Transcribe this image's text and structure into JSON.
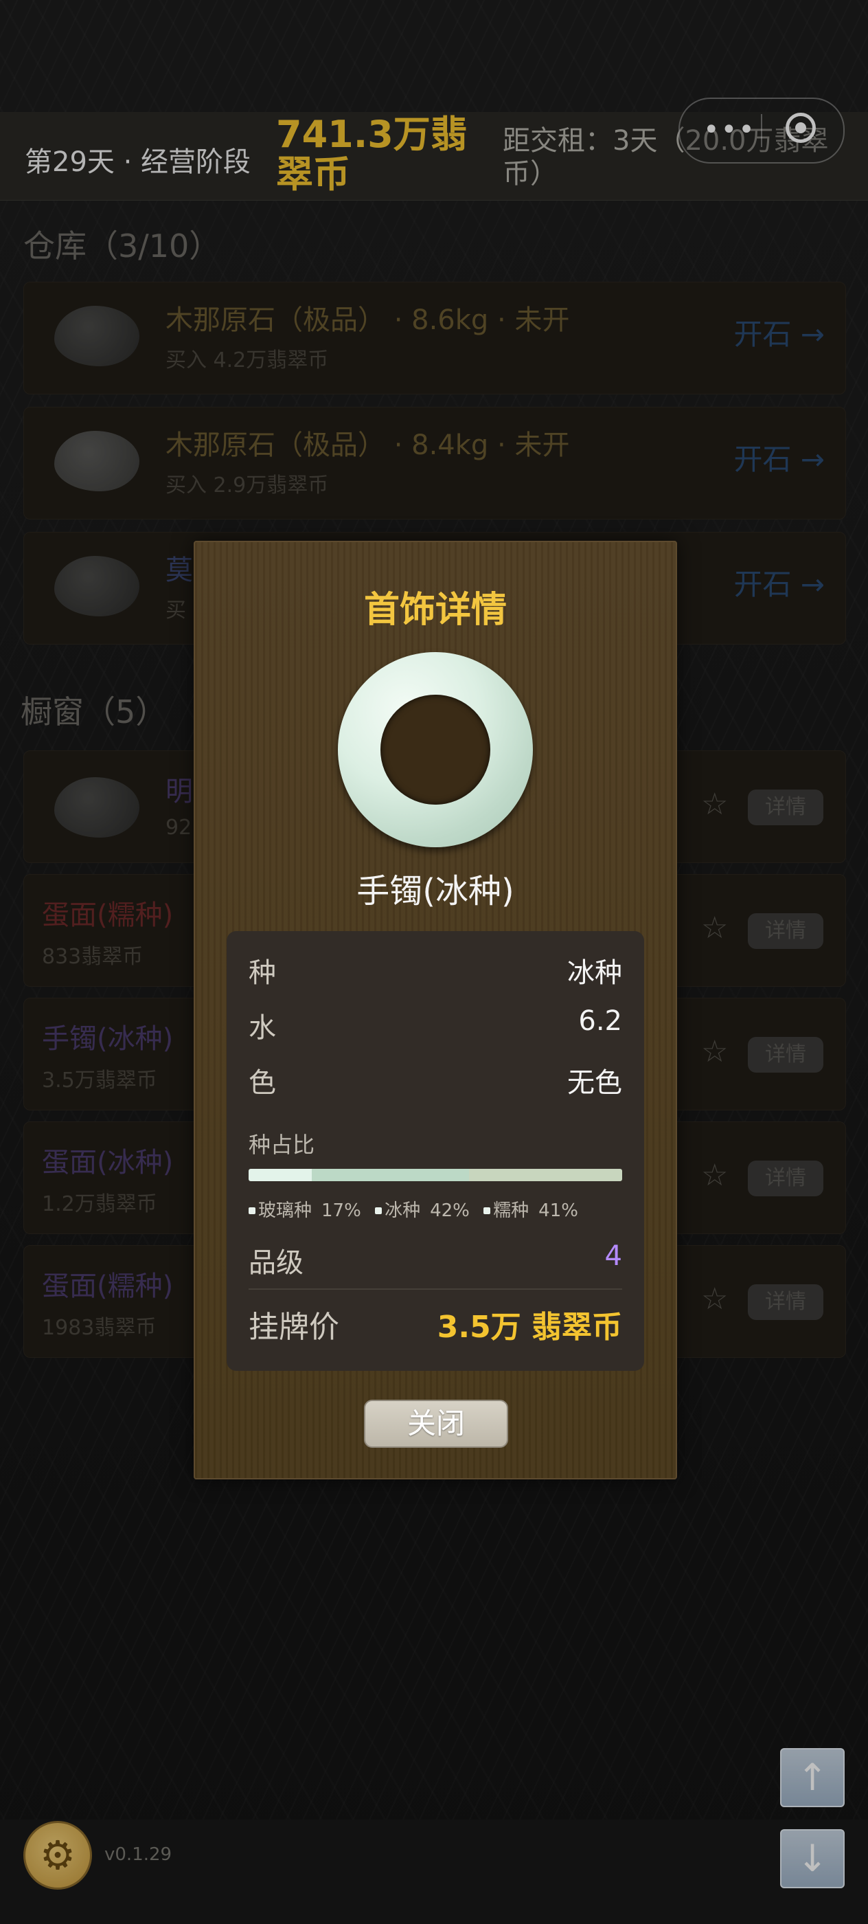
{
  "header": {
    "day_stage": "第29天 · 经营阶段",
    "money": "741.3万翡翠币",
    "rent": "距交租：3天（20.0万翡翠币）"
  },
  "capsule": {
    "more": "•••"
  },
  "warehouse": {
    "title": "仓库（3/10）",
    "items": [
      {
        "name": "木那原石（极品） · 8.6kg · 未开",
        "sub": "买入 4.2万翡翠币",
        "action": "开石 →"
      },
      {
        "name": "木那原石（极品） · 8.4kg · 未开",
        "sub": "买入 2.9万翡翠币",
        "action": "开石 →"
      },
      {
        "name": "莫",
        "sub": "买",
        "action": "开石 →"
      }
    ]
  },
  "showcase": {
    "title": "橱窗（5）",
    "items": [
      {
        "name": "明",
        "price": "92",
        "color": "#4a3b6b",
        "star": "☆",
        "detail": "详情"
      },
      {
        "name": "蛋面(糯种)",
        "price": "833翡翠币",
        "color": "#6e2a2a",
        "star": "☆",
        "detail": "详情"
      },
      {
        "name": "手镯(冰种)",
        "price": "3.5万翡翠币",
        "color": "#4a3b6b",
        "star": "☆",
        "detail": "详情"
      },
      {
        "name": "蛋面(冰种)",
        "price": "1.2万翡翠币",
        "color": "#4a3b6b",
        "star": "☆",
        "detail": "详情"
      },
      {
        "name": "蛋面(糯种)",
        "price": "1983翡翠币",
        "color": "#4a3b6b",
        "star": "☆",
        "detail": "详情"
      }
    ]
  },
  "modal": {
    "title": "首饰详情",
    "item_name": "手镯(冰种)",
    "attributes": [
      {
        "key": "种",
        "value": "冰种"
      },
      {
        "key": "水",
        "value": "6.2"
      },
      {
        "key": "色",
        "value": "无色"
      }
    ],
    "ratio_title": "种占比",
    "ratios": [
      {
        "name": "玻璃种",
        "pct": "17%",
        "fraction": 0.17,
        "color": "#e3f3ea"
      },
      {
        "name": "冰种",
        "pct": "42%",
        "fraction": 0.42,
        "color": "#bcd9c6"
      },
      {
        "name": "糯种",
        "pct": "41%",
        "fraction": 0.41,
        "color": "#c8d6be"
      }
    ],
    "grade_label": "品级",
    "grade_value": "4",
    "price_label": "挂牌价",
    "price_value": "3.5万 翡翠币",
    "close_label": "关闭"
  },
  "footer": {
    "settings_icon": "gear-icon",
    "version": "v0.1.29",
    "scroll_up_icon": "arrow-up-icon",
    "scroll_down_icon": "arrow-down-icon"
  }
}
